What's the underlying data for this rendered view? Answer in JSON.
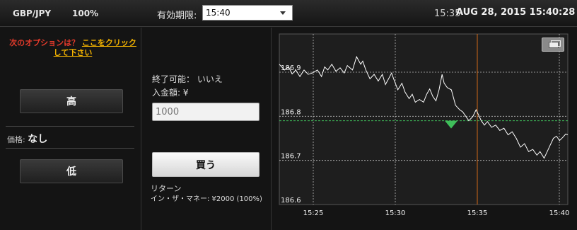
{
  "header": {
    "pair": "GBP/JPY",
    "payout": "100%",
    "expiry_label": "有効期限:",
    "expiry_value": "15:40",
    "clock_time": "15:35",
    "clock_date": "AUG 28, 2015 15:40:28"
  },
  "left": {
    "notice_prefix": "次のオプションは？",
    "notice_link": "ここをクリックして下さい",
    "high_label": "高",
    "price_label": "価格:",
    "price_value": "なし",
    "low_label": "低"
  },
  "middle": {
    "closable": "終了可能： いいえ",
    "deposit_label": "入金額: ¥",
    "amount_placeholder": "1000",
    "buy_label": "買う",
    "return_label": "リターン",
    "return_value": "イン・ザ・マネー: ¥2000 (100%)"
  },
  "chart_data": {
    "type": "line",
    "y_ticks": [
      "186.9",
      "186.8",
      "186.7",
      "186.6"
    ],
    "x_ticks": [
      "15:25",
      "15:30",
      "15:35",
      "15:40"
    ],
    "ylim": [
      186.6,
      186.95
    ],
    "entry_level": 186.79,
    "vertical_marker_time": "15:35",
    "colors": {
      "line": "#ffffff",
      "entry": "#3fbf5a",
      "marker": "#d06818",
      "grid": "#bbbbbb"
    },
    "series": [
      {
        "values": [
          [
            0.0,
            186.918
          ],
          [
            0.25,
            186.905
          ],
          [
            0.45,
            186.912
          ],
          [
            0.62,
            186.896
          ],
          [
            0.8,
            186.905
          ],
          [
            1.0,
            186.89
          ],
          [
            1.2,
            186.905
          ],
          [
            1.4,
            186.895
          ],
          [
            1.6,
            186.898
          ],
          [
            1.85,
            186.905
          ],
          [
            2.05,
            186.89
          ],
          [
            2.2,
            186.912
          ],
          [
            2.35,
            186.905
          ],
          [
            2.55,
            186.918
          ],
          [
            2.75,
            186.902
          ],
          [
            2.95,
            186.91
          ],
          [
            3.15,
            186.898
          ],
          [
            3.3,
            186.915
          ],
          [
            3.55,
            186.905
          ],
          [
            3.75,
            186.935
          ],
          [
            3.95,
            186.918
          ],
          [
            4.05,
            186.925
          ],
          [
            4.2,
            186.905
          ],
          [
            4.4,
            186.885
          ],
          [
            4.6,
            186.895
          ],
          [
            4.8,
            186.88
          ],
          [
            5.0,
            186.895
          ],
          [
            5.15,
            186.872
          ],
          [
            5.3,
            186.885
          ],
          [
            5.45,
            186.898
          ],
          [
            5.55,
            186.885
          ],
          [
            5.75,
            186.86
          ],
          [
            5.95,
            186.875
          ],
          [
            6.1,
            186.855
          ],
          [
            6.3,
            186.84
          ],
          [
            6.45,
            186.85
          ],
          [
            6.6,
            186.832
          ],
          [
            6.8,
            186.838
          ],
          [
            7.0,
            186.832
          ],
          [
            7.15,
            186.85
          ],
          [
            7.3,
            186.862
          ],
          [
            7.45,
            186.845
          ],
          [
            7.6,
            186.835
          ],
          [
            7.75,
            186.86
          ],
          [
            7.9,
            186.895
          ],
          [
            8.0,
            186.875
          ],
          [
            8.15,
            186.865
          ],
          [
            8.35,
            186.86
          ],
          [
            8.55,
            186.825
          ],
          [
            8.75,
            186.815
          ],
          [
            8.9,
            186.81
          ],
          [
            9.05,
            186.8
          ],
          [
            9.2,
            186.79
          ],
          [
            9.4,
            186.8
          ],
          [
            9.55,
            186.815
          ],
          [
            9.65,
            186.805
          ],
          [
            9.8,
            186.79
          ],
          [
            9.95,
            186.78
          ],
          [
            10.1,
            186.788
          ],
          [
            10.3,
            186.775
          ],
          [
            10.5,
            186.78
          ],
          [
            10.7,
            186.768
          ],
          [
            10.9,
            186.773
          ],
          [
            11.1,
            186.758
          ],
          [
            11.3,
            186.765
          ],
          [
            11.5,
            186.75
          ],
          [
            11.7,
            186.73
          ],
          [
            11.9,
            186.738
          ],
          [
            12.1,
            186.72
          ],
          [
            12.3,
            186.725
          ],
          [
            12.5,
            186.712
          ],
          [
            12.65,
            186.72
          ],
          [
            12.85,
            186.705
          ],
          [
            13.0,
            186.72
          ],
          [
            13.15,
            186.735
          ],
          [
            13.3,
            186.75
          ],
          [
            13.45,
            186.755
          ],
          [
            13.6,
            186.745
          ],
          [
            13.75,
            186.752
          ],
          [
            13.9,
            186.76
          ],
          [
            14.0,
            186.758
          ]
        ]
      }
    ]
  }
}
